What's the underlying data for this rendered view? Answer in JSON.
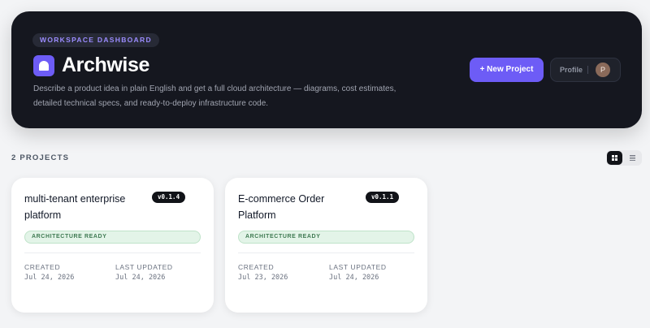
{
  "header": {
    "eyebrow": "WORKSPACE DASHBOARD",
    "title": "Archwise",
    "description": "Describe a product idea in plain English and get a full cloud architecture — diagrams, cost estimates, detailed technical specs, and ready-to-deploy infrastructure code.",
    "new_project_label": "+ New Project",
    "profile_label": "Profile",
    "avatar_initial": "P"
  },
  "projects": {
    "count_label": "2 PROJECTS",
    "view_modes": [
      "grid-icon",
      "list-icon"
    ],
    "active_view": "grid",
    "items": [
      {
        "title": "multi-tenant enterprise platform",
        "version": "v0.1.4",
        "status": "ARCHITECTURE READY",
        "created_label": "CREATED",
        "created": "Jul 24, 2026",
        "updated_label": "LAST UPDATED",
        "updated": "Jul 24, 2026"
      },
      {
        "title": "E-commerce Order Platform",
        "version": "v0.1.1",
        "status": "ARCHITECTURE READY",
        "created_label": "CREATED",
        "created": "Jul 23, 2026",
        "updated_label": "LAST UPDATED",
        "updated": "Jul 24, 2026"
      }
    ]
  },
  "colors": {
    "accent": "#6d5cf6",
    "hero_bg": "#15171f",
    "status_bg": "#e3f4e8",
    "status_text": "#3f7a52"
  }
}
